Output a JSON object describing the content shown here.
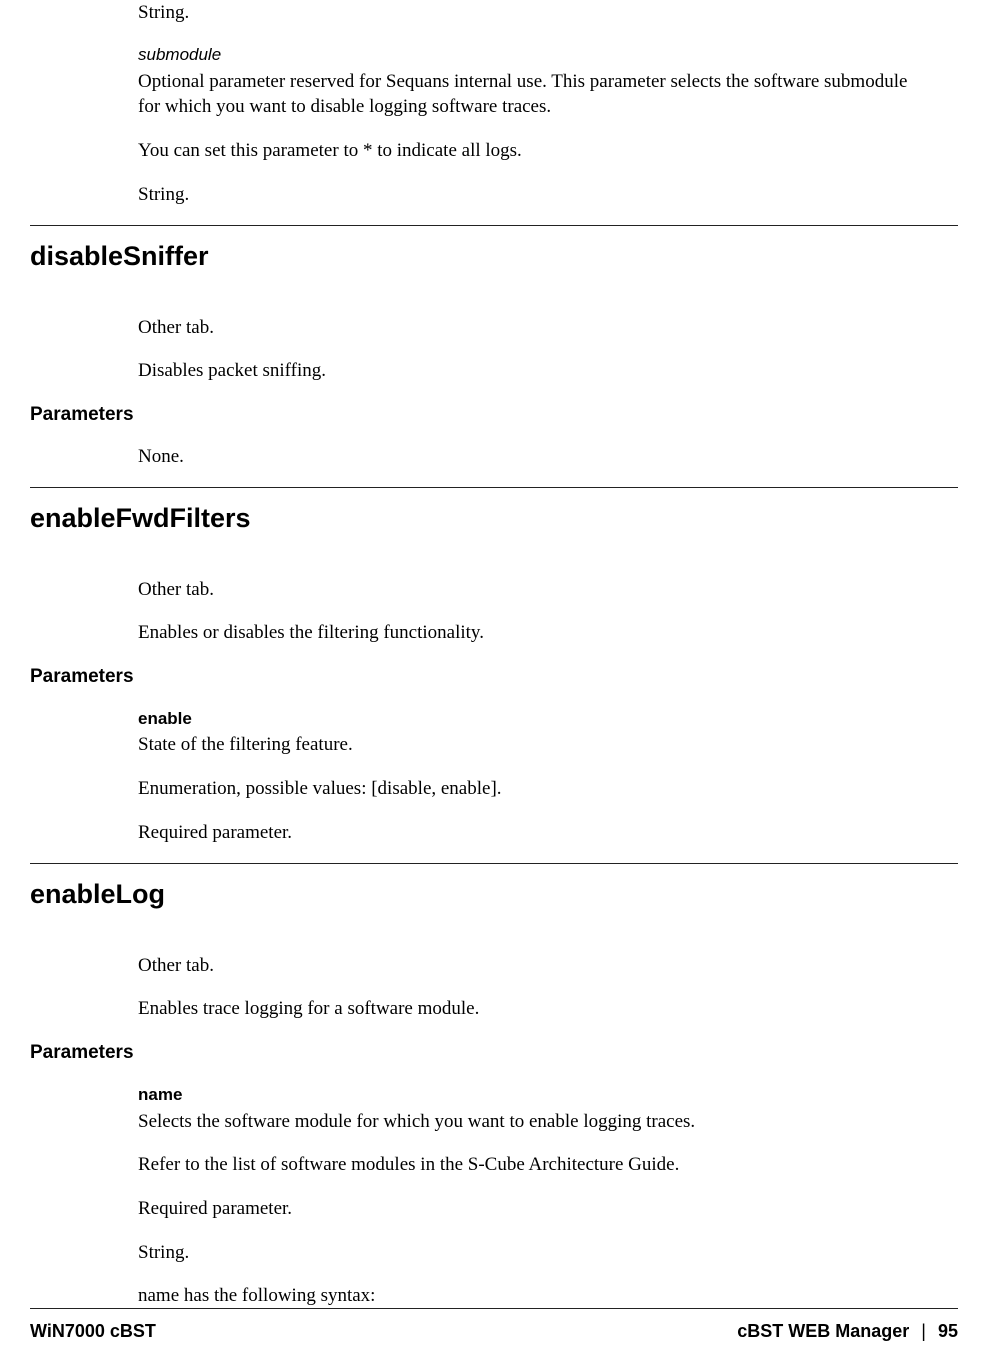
{
  "intro": {
    "p1": "String.",
    "param_label": "submodule",
    "p2": "Optional parameter reserved for Sequans internal use. This parameter selects the software submodule for which you want to disable logging software traces.",
    "p3": "You can set this parameter to * to indicate all logs.",
    "p4": "String."
  },
  "s1": {
    "title": "disableSniffer",
    "p1": "Other tab.",
    "p2": "Disables packet sniffing.",
    "params_heading": "Parameters",
    "p3": "None."
  },
  "s2": {
    "title": "enableFwdFilters",
    "p1": "Other tab.",
    "p2": "Enables or disables the filtering functionality.",
    "params_heading": "Parameters",
    "param_label": "enable",
    "p3": "State of the filtering feature.",
    "p4": "Enumeration, possible values: [disable, enable].",
    "p5": "Required parameter."
  },
  "s3": {
    "title": "enableLog",
    "p1": "Other tab.",
    "p2": "Enables trace logging for a software module.",
    "params_heading": "Parameters",
    "param_label": "name",
    "p3": "Selects the software module for which you want to enable logging traces.",
    "p4": "Refer to the list of software modules in the S-Cube Architecture Guide.",
    "p5": "Required parameter.",
    "p6": "String.",
    "p7": "name has the following syntax:"
  },
  "footer": {
    "left": "WiN7000 cBST",
    "right_label": "cBST WEB Manager",
    "sep": "|",
    "page": "95"
  }
}
